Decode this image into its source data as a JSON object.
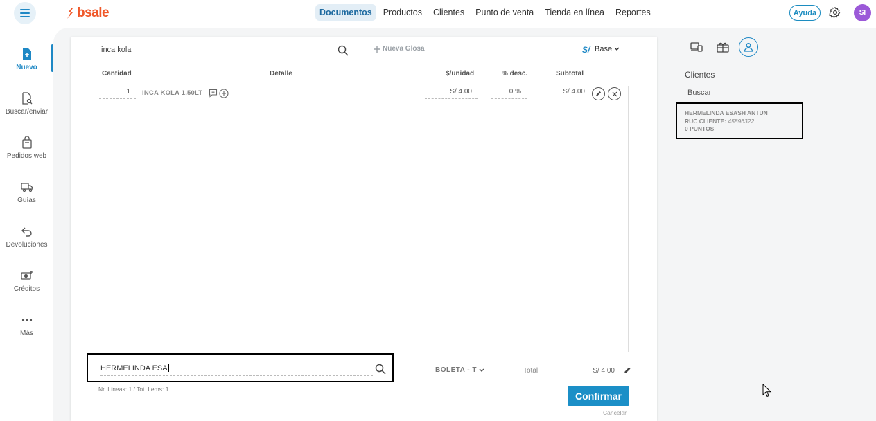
{
  "app": {
    "logo_text": "bsale",
    "brand_color": "#f0582a",
    "accent_color": "#1e88c5"
  },
  "topnav": {
    "items": [
      {
        "label": "Documentos",
        "active": true
      },
      {
        "label": "Productos"
      },
      {
        "label": "Clientes"
      },
      {
        "label": "Punto de venta"
      },
      {
        "label": "Tienda en línea"
      },
      {
        "label": "Reportes"
      }
    ],
    "help_label": "Ayuda",
    "avatar_initials": "SI"
  },
  "sidebar": {
    "items": [
      {
        "label": "Nuevo",
        "icon": "new-document-icon",
        "active": true
      },
      {
        "label": "Buscar/enviar",
        "icon": "search-document-icon"
      },
      {
        "label": "Pedidos web",
        "icon": "shopping-bag-icon"
      },
      {
        "label": "Guías",
        "icon": "truck-icon"
      },
      {
        "label": "Devoluciones",
        "icon": "return-arrow-icon"
      },
      {
        "label": "Créditos",
        "icon": "money-add-icon"
      },
      {
        "label": "Más",
        "icon": "more-dots-icon"
      }
    ]
  },
  "document": {
    "product_search_value": "inca kola",
    "new_glosa_label": "Nueva Glosa",
    "currency_symbol": "S/",
    "price_list": "Base",
    "columns": {
      "quantity": "Cantidad",
      "detail": "Detalle",
      "unit_price": "$/unidad",
      "discount": "% desc.",
      "subtotal": "Subtotal"
    },
    "rows": [
      {
        "quantity": "1",
        "product": "INCA KOLA 1.50LT",
        "unit_price": "S/ 4.00",
        "discount": "0 %",
        "subtotal": "S/ 4.00"
      }
    ],
    "client_search_value": "HERMELINDA ESA",
    "lines_info": "Nr. Líneas: 1 / Tot. Items: 1",
    "document_type": "BOLETA - T",
    "total_label": "Total",
    "total_value": "S/ 4.00",
    "confirm_label": "Confirmar",
    "cancel_label": "Cancelar"
  },
  "clients_panel": {
    "title": "Clientes",
    "search_placeholder": "Buscar",
    "results": [
      {
        "name": "HERMELINDA ESASH ANTUN",
        "ruc_label": "RUC CLIENTE:",
        "ruc": "45896322",
        "points": "0 PUNTOS"
      }
    ]
  }
}
